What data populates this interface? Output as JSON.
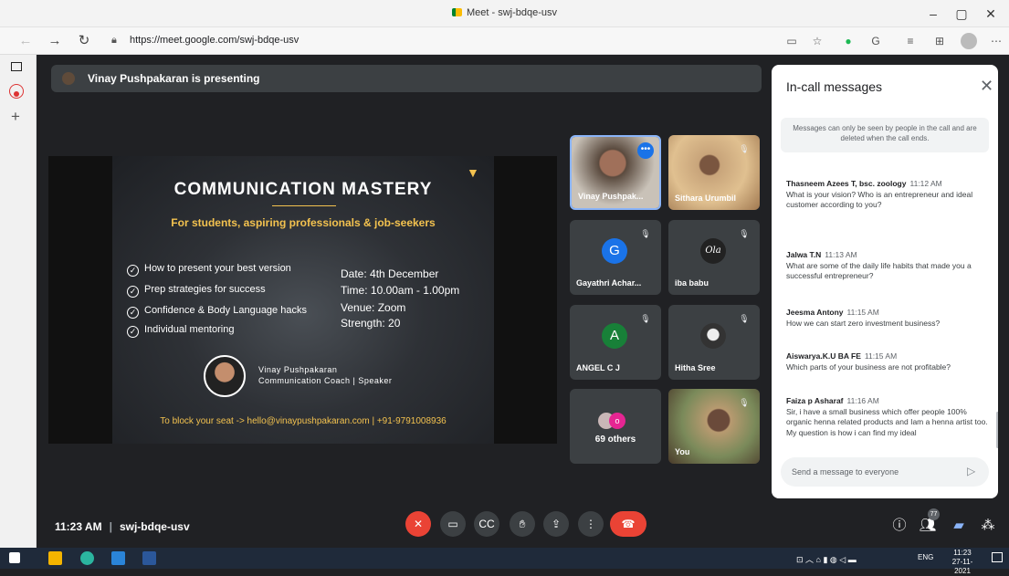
{
  "browser": {
    "window_title": "Meet - swj-bdqe-usv",
    "url": "https://meet.google.com/swj-bdqe-usv"
  },
  "meet": {
    "presenting_text": "Vinay Pushpakaran is presenting",
    "time": "11:23 AM",
    "separator": "|",
    "meeting_code": "swj-bdqe-usv",
    "people_count": "77"
  },
  "slide": {
    "title": "COMMUNICATION MASTERY",
    "subtitle": "For students, aspiring professionals & job-seekers",
    "bullets": [
      "How to present your best version",
      "Prep strategies for success",
      "Confidence & Body Language hacks",
      "Individual mentoring"
    ],
    "info": [
      "Date: 4th December",
      "Time: 10.00am - 1.00pm",
      "Venue: Zoom",
      "Strength: 20"
    ],
    "speaker_name": "Vinay Pushpakaran",
    "speaker_role": "Communication Coach | Speaker",
    "contact": "To block your seat -> hello@vinaypushpakaran.com | +91-9791008936"
  },
  "tiles": [
    {
      "name": "Vinay Pushpak...",
      "kind": "video"
    },
    {
      "name": "Sithara Urumbil",
      "kind": "video"
    },
    {
      "name": "Gayathri Achar...",
      "initial": "G",
      "color": "#1a73e8"
    },
    {
      "name": "iba babu",
      "logo": "Ola"
    },
    {
      "name": "ANGEL C J",
      "initial": "A",
      "color": "#188038"
    },
    {
      "name": "Hitha Sree",
      "kind": "photo"
    },
    {
      "name": "69 others",
      "kind": "others"
    },
    {
      "name": "You",
      "kind": "video"
    }
  ],
  "chat": {
    "title": "In-call messages",
    "notice": "Messages can only be seen by people in the call and are deleted when the call ends.",
    "messages": [
      {
        "sender": "Thasneem Azees T, bsc. zoology",
        "time": "11:12 AM",
        "text": "What is your vision? Who is an entrepreneur and ideal customer according to you?"
      },
      {
        "sender": "Jalwa T.N",
        "time": "11:13 AM",
        "text": "What are some of the daily life habits that made you a successful entrepreneur?"
      },
      {
        "sender": "Jeesma Antony",
        "time": "11:15 AM",
        "text": "How we can start zero investment business?"
      },
      {
        "sender": "Aiswarya.K.U BA FE",
        "time": "11:15 AM",
        "text": "Which parts of your business are not profitable?"
      },
      {
        "sender": "Faiza p Asharaf",
        "time": "11:16 AM",
        "text": "Sir, i have a small business which offer people 100% organic henna related products and Iam a henna artist too. My question is how i can find my ideal"
      }
    ],
    "input_placeholder": "Send a message to everyone"
  },
  "taskbar": {
    "lang": "ENG",
    "clock_time": "11:23",
    "clock_date": "27-11-2021"
  },
  "colors": {
    "end_call": "#ea4335",
    "meet_bg": "#202124",
    "accent": "#1a73e8"
  }
}
